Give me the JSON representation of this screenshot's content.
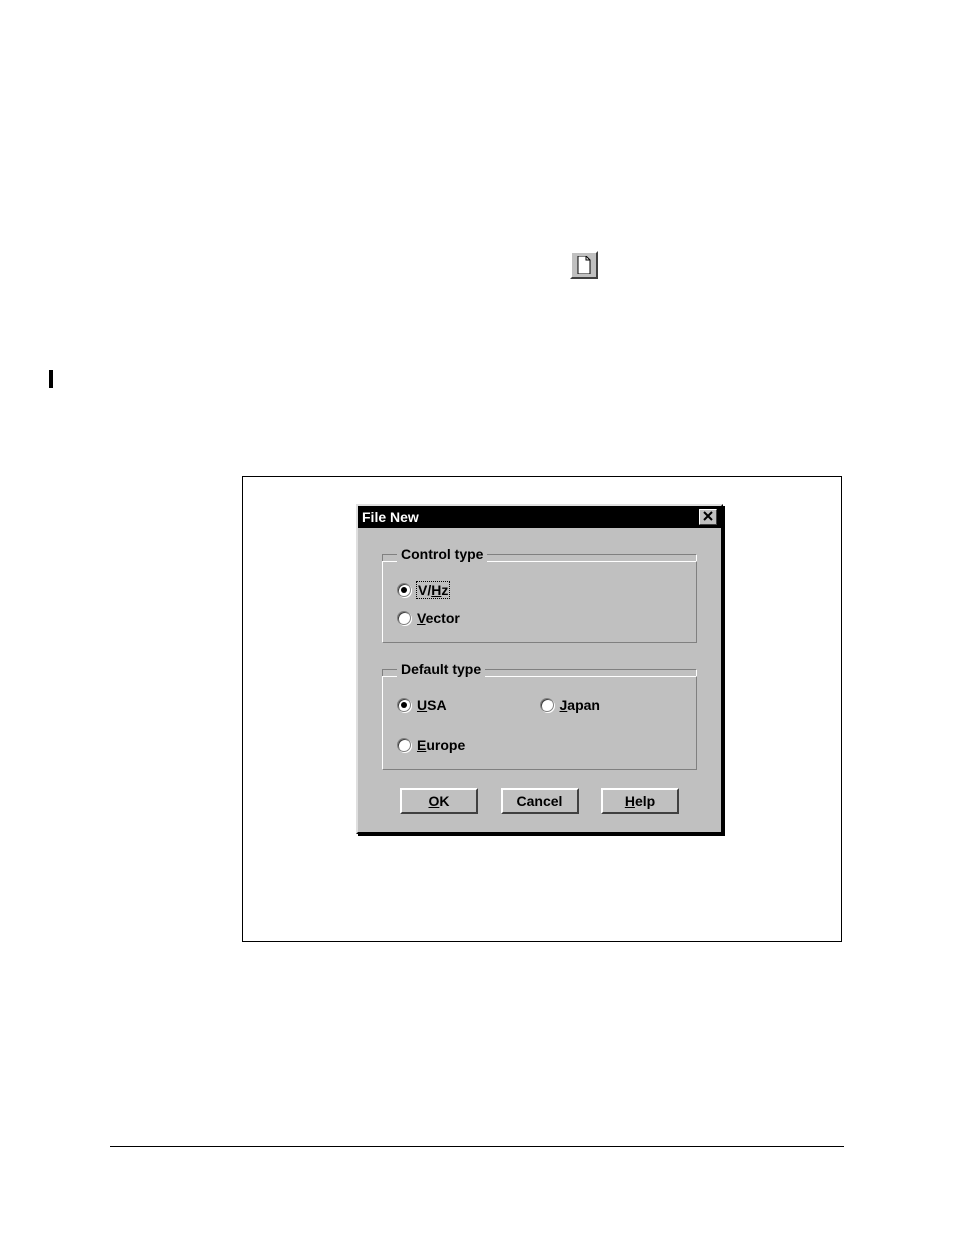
{
  "toolbar": {
    "new_file_icon": "new-file-icon"
  },
  "dialog": {
    "title": "File New",
    "close_label": "×",
    "control_type": {
      "legend": "Control type",
      "options": [
        {
          "label_pre": "V/",
          "underline": "H",
          "label_post": "z",
          "selected": true,
          "focused": true
        },
        {
          "label_pre": "",
          "underline": "V",
          "label_post": "ector",
          "selected": false,
          "focused": false
        }
      ]
    },
    "default_type": {
      "legend": "Default type",
      "options": [
        {
          "label_pre": "",
          "underline": "U",
          "label_post": "SA",
          "selected": true
        },
        {
          "label_pre": "",
          "underline": "J",
          "label_post": "apan",
          "selected": false
        },
        {
          "label_pre": "",
          "underline": "E",
          "label_post": "urope",
          "selected": false
        }
      ]
    },
    "buttons": {
      "ok": {
        "underline": "O",
        "rest": "K"
      },
      "cancel": {
        "text": "Cancel"
      },
      "help": {
        "underline": "H",
        "rest": "elp"
      }
    }
  }
}
